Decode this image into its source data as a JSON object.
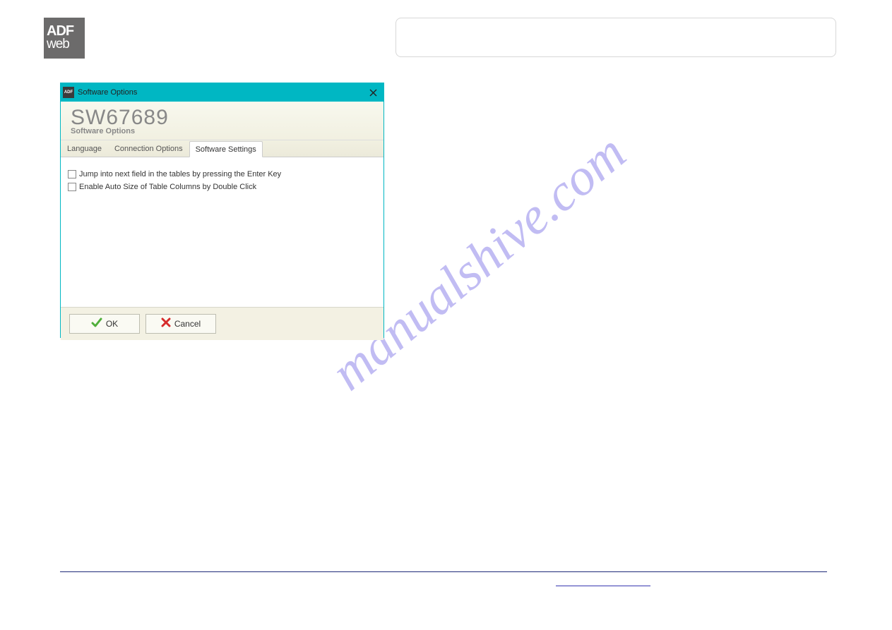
{
  "logo": {
    "line1": "ADF",
    "line2": "web"
  },
  "watermark": "manualshive.com",
  "dialog": {
    "title": "Software Options",
    "icon_label": "ADF",
    "code": "SW67689",
    "subtitle": "Software Options",
    "tabs": [
      {
        "label": "Language",
        "active": false
      },
      {
        "label": "Connection Options",
        "active": false
      },
      {
        "label": "Software Settings",
        "active": true
      }
    ],
    "checkboxes": [
      {
        "label": "Jump into next field in the tables by pressing the Enter Key",
        "checked": false
      },
      {
        "label": "Enable Auto Size of Table Columns by Double Click",
        "checked": false
      }
    ],
    "buttons": {
      "ok": "OK",
      "cancel": "Cancel"
    }
  }
}
